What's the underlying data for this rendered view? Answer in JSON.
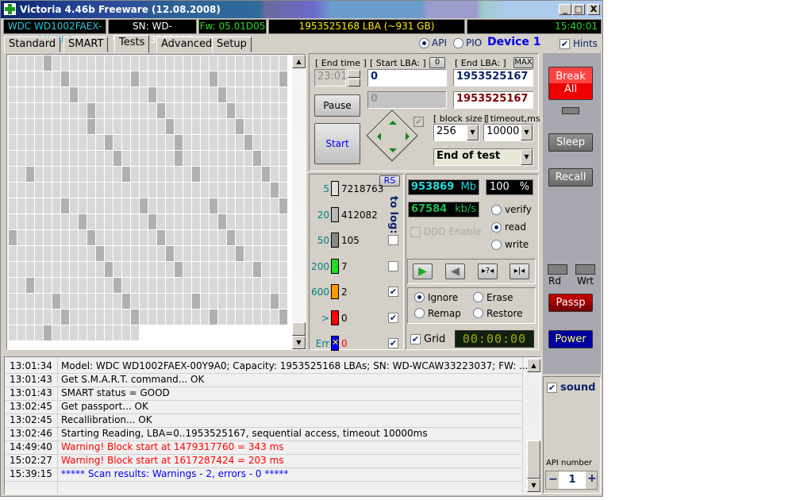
{
  "window": {
    "title": "Victoria 4.46b Freeware (12.08.2008)",
    "controls": [
      "_",
      "□",
      "X"
    ]
  },
  "info_bar": {
    "model": "WDC WD1002FAEX-00Y9A0",
    "serial": "SN: WD-WCAW33223037",
    "firmware": "Fw: 05.01D05",
    "capacity": "1953525168 LBA (~931 GB)",
    "clock": "15:40:01"
  },
  "tabs": [
    {
      "label": "Standard"
    },
    {
      "label": "SMART"
    },
    {
      "label": "Tests",
      "active": true
    },
    {
      "label": "Advanced"
    },
    {
      "label": "Setup"
    }
  ],
  "interface": {
    "api_label": "API",
    "pio_label": "PIO",
    "selected": "API",
    "device": "Device 1",
    "hints_label": "Hints",
    "hints_checked": true
  },
  "scan_grid": {
    "rows": 18,
    "cols": 32,
    "last_row_cells": 15,
    "dark_cells": [
      [
        4
      ],
      [
        6,
        14,
        23,
        31
      ],
      [
        7,
        16,
        24
      ],
      [
        9,
        17,
        25
      ],
      [
        9,
        18,
        26
      ],
      [
        11,
        19,
        27
      ],
      [
        12,
        19,
        28
      ],
      [
        2,
        13,
        21,
        29
      ],
      [
        30
      ],
      [
        6,
        15,
        23,
        31
      ],
      [
        8,
        16,
        24
      ],
      [
        0,
        9,
        17,
        25
      ],
      [
        10,
        18,
        26
      ],
      [
        11,
        19,
        28
      ],
      [
        2,
        12
      ],
      [
        5,
        13,
        21,
        30
      ],
      [
        6,
        14,
        23,
        31
      ],
      [
        4
      ]
    ]
  },
  "controls": {
    "end_time_label": "[ End time ]",
    "end_time": "23:01",
    "start_lba_label": "[ Start LBA: ]",
    "start_lba_zero": "0",
    "start_lba": "0",
    "current_lba": "0",
    "end_lba_label": "[ End LBA: ]",
    "end_lba_max": "MAX",
    "end_lba": "1953525167",
    "end_lba2": "1953525167",
    "pause": "Pause",
    "start": "Start",
    "block_size_label": "[ block size ]",
    "block_size": "256",
    "timeout_label": "[ timeout,ms ]",
    "timeout": "10000",
    "end_action": "End of test"
  },
  "stats": {
    "rs": "RS",
    "to_log": "to log:",
    "rows": [
      {
        "ms": "5",
        "count": "7218763",
        "color": "#e0e0e0",
        "log": null
      },
      {
        "ms": "20",
        "count": "412082",
        "color": "#b8b8b8",
        "log": null
      },
      {
        "ms": "50",
        "count": "105",
        "color": "#888888",
        "log": false
      },
      {
        "ms": "200",
        "count": "7",
        "color": "#22dd22",
        "log": false
      },
      {
        "ms": "600",
        "count": "2",
        "color": "#ff9900",
        "log": true
      },
      {
        "ms": ">",
        "count": "0",
        "color": "#ff0000",
        "log": true
      },
      {
        "ms": "Err",
        "count": "0",
        "color": "#0000ff",
        "log": true
      }
    ]
  },
  "progress": {
    "mb": "953869",
    "mb_unit": "Mb",
    "percent": "100",
    "percent_unit": "%",
    "speed": "67584",
    "speed_unit": "kb/s",
    "percent_value": 100
  },
  "mode": {
    "options": [
      "verify",
      "read",
      "write"
    ],
    "selected": "read",
    "ddd": "DDD Enable"
  },
  "actions": {
    "options": [
      "Ignore",
      "Erase",
      "Remap",
      "Restore"
    ],
    "selected": "Ignore"
  },
  "grid_toggle": {
    "label": "Grid",
    "checked": true,
    "timer": "00:00:00"
  },
  "side": {
    "break": "Break\nAll",
    "sleep": "Sleep",
    "recall": "Recall",
    "rd": "Rd",
    "wrt": "Wrt",
    "passp": "Passp",
    "power": "Power",
    "sound": "sound",
    "api_number_label": "API number",
    "api_number": "1",
    "minus": "−",
    "plus": "+"
  },
  "log": [
    {
      "time": "13:01:34",
      "msg": "Model: WDC WD1002FAEX-00Y9A0; Capacity: 1953525168 LBAs; SN: WD-WCAW33223037; FW: ...",
      "color": "#000000"
    },
    {
      "time": "13:01:43",
      "msg": "Get S.M.A.R.T. command... OK",
      "color": "#000000"
    },
    {
      "time": "13:01:43",
      "msg": "SMART status = GOOD",
      "color": "#000000"
    },
    {
      "time": "13:02:45",
      "msg": "Get passport... OK",
      "color": "#000000"
    },
    {
      "time": "13:02:45",
      "msg": "Recallibration... OK",
      "color": "#000000"
    },
    {
      "time": "13:02:46",
      "msg": "Starting Reading, LBA=0..1953525167, sequential access, timeout 10000ms",
      "color": "#000000"
    },
    {
      "time": "14:49:40",
      "msg": "Warning! Block start at 1479317760 = 343 ms",
      "color": "#ff0000"
    },
    {
      "time": "15:02:27",
      "msg": "Warning! Block start at 1617287424 = 203 ms",
      "color": "#ff0000"
    },
    {
      "time": "15:39:15",
      "msg": "***** Scan results: Warnings - 2, errors - 0 *****",
      "color": "#0000ff"
    }
  ]
}
